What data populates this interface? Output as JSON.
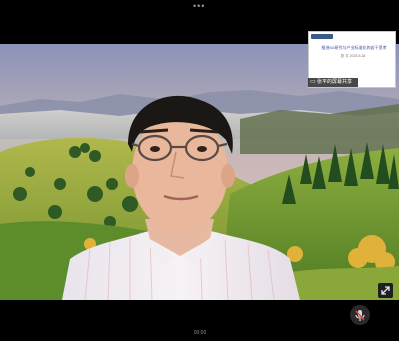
{
  "top": {
    "dots": "•••"
  },
  "screen_share": {
    "title": "推进6G研究与产业标准化的若干思考",
    "subtitle": "张  平  2023.5.18",
    "label": "张平的屏幕共享",
    "label_icon": "screen-share-icon"
  },
  "controls": {
    "expand_icon": "expand-icon",
    "mic_icon": "microphone-muted-icon"
  },
  "bottom": {
    "time": "00:00"
  },
  "colors": {
    "background": "#000000",
    "sky": "#9aa6c2",
    "grass": "#7fa13a"
  }
}
